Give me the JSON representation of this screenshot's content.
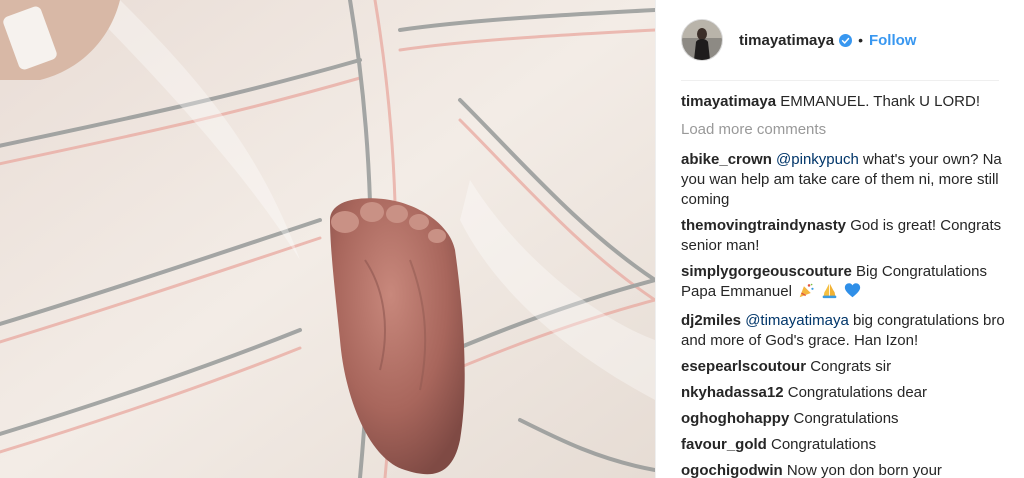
{
  "post": {
    "username": "timayatimaya",
    "follow_label": "Follow",
    "separator": "•",
    "caption_user": "timayatimaya",
    "caption_text": "EMMANUEL. Thank U LORD!",
    "load_more": "Load more comments"
  },
  "comments": [
    {
      "user": "abike_crown",
      "mention": "@pinkypuch",
      "text": " what's your own? Na you wan help am take care of them ni, more still coming"
    },
    {
      "user": "themovingtraindynasty",
      "mention": "",
      "text": " God is great! Congrats senior man!"
    },
    {
      "user": "simplygorgeouscouture",
      "mention": "",
      "text": " Big Congratulations Papa Emmanuel"
    },
    {
      "user": "dj2miles",
      "mention": "@timayatimaya",
      "text": " big congratulations bro and more of God's grace. Han Izon!"
    },
    {
      "user": "esepearlscoutour",
      "mention": "",
      "text": " Congrats sir"
    },
    {
      "user": "nkyhadassa12",
      "mention": "",
      "text": " Congratulations dear"
    },
    {
      "user": "oghoghohappy",
      "mention": "",
      "text": " Congratulations"
    },
    {
      "user": "favour_gold",
      "mention": "",
      "text": " Congratulations"
    },
    {
      "user": "ogochigodwin",
      "mention": "",
      "text": " Now yon don born your"
    }
  ],
  "icons": {
    "verified": "verified-badge-icon",
    "emojis": [
      "party-popper-icon",
      "praying-hands-icon",
      "blue-heart-icon"
    ]
  },
  "colors": {
    "accent": "#3897f0",
    "mention": "#003569",
    "muted": "#999999",
    "text": "#262626"
  }
}
